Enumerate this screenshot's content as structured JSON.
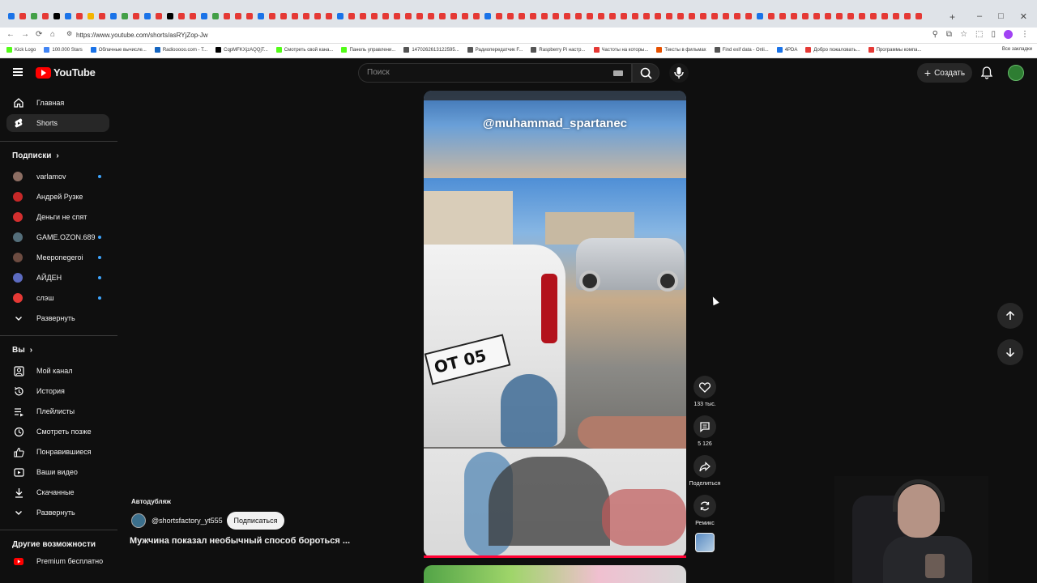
{
  "browser": {
    "url": "https://www.youtube.com/shorts/asRYjZop-Jw",
    "tab_icon_colors": [
      "#1a73e8",
      "#e53935",
      "#43a047",
      "#e53935",
      "#000000",
      "#1a73e8",
      "#e53935",
      "#f4b400",
      "#e53935",
      "#1a73e8",
      "#43a047",
      "#e53935",
      "#1a73e8",
      "#e53935",
      "#000000",
      "#e53935",
      "#e53935",
      "#1a73e8",
      "#43a047",
      "#e53935",
      "#e53935",
      "#e53935",
      "#1a73e8",
      "#e53935",
      "#e53935",
      "#e53935",
      "#e53935",
      "#e53935",
      "#e53935",
      "#1a73e8",
      "#e53935",
      "#e53935",
      "#e53935",
      "#e53935",
      "#e53935",
      "#e53935",
      "#e53935",
      "#e53935",
      "#e53935",
      "#e53935",
      "#e53935",
      "#e53935",
      "#1a73e8",
      "#e53935",
      "#e53935",
      "#e53935",
      "#e53935",
      "#e53935",
      "#e53935",
      "#e53935",
      "#e53935",
      "#e53935",
      "#e53935",
      "#e53935",
      "#e53935",
      "#e53935",
      "#e53935",
      "#e53935",
      "#e53935",
      "#e53935",
      "#e53935",
      "#e53935",
      "#e53935",
      "#e53935",
      "#e53935",
      "#e53935",
      "#1a73e8",
      "#e53935",
      "#e53935",
      "#e53935",
      "#e53935",
      "#e53935",
      "#e53935",
      "#e53935",
      "#e53935",
      "#e53935",
      "#e53935",
      "#e53935",
      "#e53935",
      "#e53935",
      "#e53935"
    ],
    "new_tab": "+",
    "window_controls": [
      "–",
      "□",
      "✕"
    ],
    "bookmarks": [
      {
        "label": "Kick Logo",
        "color": "#53fc18"
      },
      {
        "label": "100.000 Stars",
        "color": "#4285f4"
      },
      {
        "label": "Облачные вычисле...",
        "color": "#1a73e8"
      },
      {
        "label": "Radiooooo.com - T...",
        "color": "#1565c0"
      },
      {
        "label": "CqpMFKXjzAQQjT...",
        "color": "#000000"
      },
      {
        "label": "Смотреть свой кана...",
        "color": "#53fc18"
      },
      {
        "label": "Панель управлени...",
        "color": "#53fc18"
      },
      {
        "label": "1470262613122595...",
        "color": "#555555"
      },
      {
        "label": "Радиопередатчик F...",
        "color": "#555555"
      },
      {
        "label": "Raspberry Pi настр...",
        "color": "#555555"
      },
      {
        "label": "Частоты на которы...",
        "color": "#e53935"
      },
      {
        "label": "Тексты в фильмах",
        "color": "#e65100"
      },
      {
        "label": "Find exif data - Onli...",
        "color": "#555555"
      },
      {
        "label": "4PDA",
        "color": "#1a73e8"
      },
      {
        "label": "Добро пожаловать...",
        "color": "#e53935"
      },
      {
        "label": "Программы компа...",
        "color": "#e53935"
      }
    ],
    "all_bookmarks": "Все закладки"
  },
  "header": {
    "logo_text": "YouTube",
    "search_placeholder": "Поиск",
    "create_label": "Создать"
  },
  "sidebar": {
    "main": [
      {
        "label": "Главная",
        "icon": "home-icon",
        "active": false
      },
      {
        "label": "Shorts",
        "icon": "shorts-icon",
        "active": true
      }
    ],
    "subscriptions_title": "Подписки",
    "subscriptions": [
      {
        "label": "varlamov",
        "color": "#8d6e63",
        "live": true
      },
      {
        "label": "Андрей Рузке",
        "color": "#c62828",
        "live": false
      },
      {
        "label": "Деньги не спят",
        "color": "#d32f2f",
        "live": false
      },
      {
        "label": "GAME.OZON.689",
        "color": "#546e7a",
        "live": true
      },
      {
        "label": "Meeponegeroi",
        "color": "#6d4c41",
        "live": true
      },
      {
        "label": "АЙДЕН",
        "color": "#5c6bc0",
        "live": true
      },
      {
        "label": "слэш",
        "color": "#e53935",
        "live": true
      }
    ],
    "expand_label": "Развернуть",
    "you_title": "Вы",
    "you_items": [
      {
        "label": "Мой канал",
        "icon": "channel-icon"
      },
      {
        "label": "История",
        "icon": "history-icon"
      },
      {
        "label": "Плейлисты",
        "icon": "playlists-icon"
      },
      {
        "label": "Смотреть позже",
        "icon": "watch-later-icon"
      },
      {
        "label": "Понравившиеся",
        "icon": "like-icon"
      },
      {
        "label": "Ваши видео",
        "icon": "your-videos-icon"
      },
      {
        "label": "Скачанные",
        "icon": "download-icon"
      }
    ],
    "expand_label_2": "Развернуть",
    "more_title": "Другие возможности",
    "premium_label": "Premium бесплатно"
  },
  "video": {
    "watermark": "@muhammad_spartanec",
    "plate": "OT 05",
    "progress_fraction": 1.0
  },
  "actions": {
    "likes": "133 тыс.",
    "comments": "5 126",
    "share": "Поделиться",
    "remix": "Ремикс"
  },
  "info": {
    "tag": "Автодубляж",
    "channel": "@shortsfactory_yt555",
    "subscribe": "Подписаться",
    "title": "Мужчина показал необычный способ бороться ..."
  }
}
